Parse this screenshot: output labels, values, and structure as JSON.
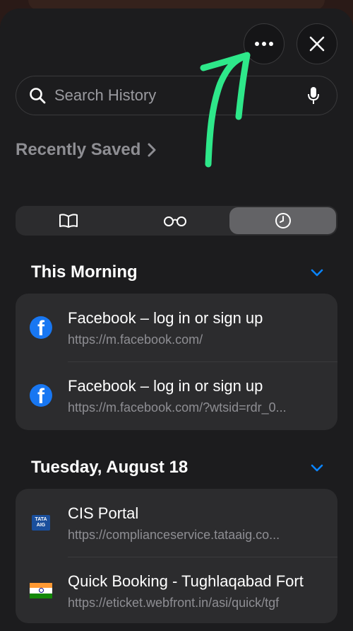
{
  "search": {
    "placeholder": "Search History"
  },
  "recently_saved": {
    "label": "Recently Saved"
  },
  "sections": [
    {
      "heading": "This Morning",
      "items": [
        {
          "title": "Facebook – log in or sign up",
          "url": "https://m.facebook.com/"
        },
        {
          "title": "Facebook – log in or sign up",
          "url": "https://m.facebook.com/?wtsid=rdr_0..."
        }
      ]
    },
    {
      "heading": "Tuesday, August 18",
      "items": [
        {
          "title": "CIS Portal",
          "url": "https://complianceservice.tataaig.co...",
          "icon_text": "TATA AIG"
        },
        {
          "title": "Quick Booking - Tughlaqabad Fort",
          "url": "https://eticket.webfront.in/asi/quick/tgf"
        }
      ]
    }
  ],
  "icons": {
    "more": "more-icon",
    "close": "close-icon",
    "search": "search-icon",
    "mic": "mic-icon",
    "bookmarks": "book-icon",
    "reading_list": "glasses-icon",
    "history": "clock-icon",
    "chevron": "chevron-right-icon",
    "collapse": "chevron-down-icon"
  },
  "colors": {
    "accent": "#0a84ff",
    "annotation": "#2ee88a",
    "background": "#1c1c1e",
    "card": "#2c2c2e"
  }
}
